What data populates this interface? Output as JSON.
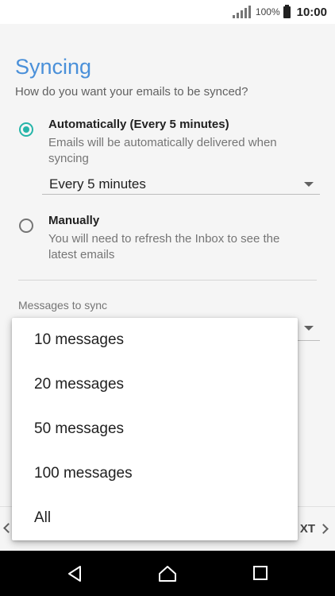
{
  "status_bar": {
    "battery_percent": "100%",
    "time": "10:00"
  },
  "page": {
    "title": "Syncing",
    "subtitle": "How do you want your emails to be synced?"
  },
  "options": [
    {
      "title": "Automatically (Every 5 minutes)",
      "description": "Emails will be automatically delivered when syncing",
      "selected": true
    },
    {
      "title": "Manually",
      "description": "You will need to refresh the Inbox to see the latest emails",
      "selected": false
    }
  ],
  "frequency_spinner": {
    "value": "Every 5 minutes"
  },
  "messages_to_sync": {
    "label": "Messages to sync"
  },
  "dropdown": {
    "items": [
      "10 messages",
      "20 messages",
      "50 messages",
      "100 messages",
      "All"
    ]
  },
  "bottom_bar": {
    "next_label": "XT"
  },
  "colors": {
    "accent": "#26b5a9",
    "title": "#4a90d9"
  },
  "nav_icons": [
    "back-icon",
    "home-icon",
    "recents-icon"
  ]
}
